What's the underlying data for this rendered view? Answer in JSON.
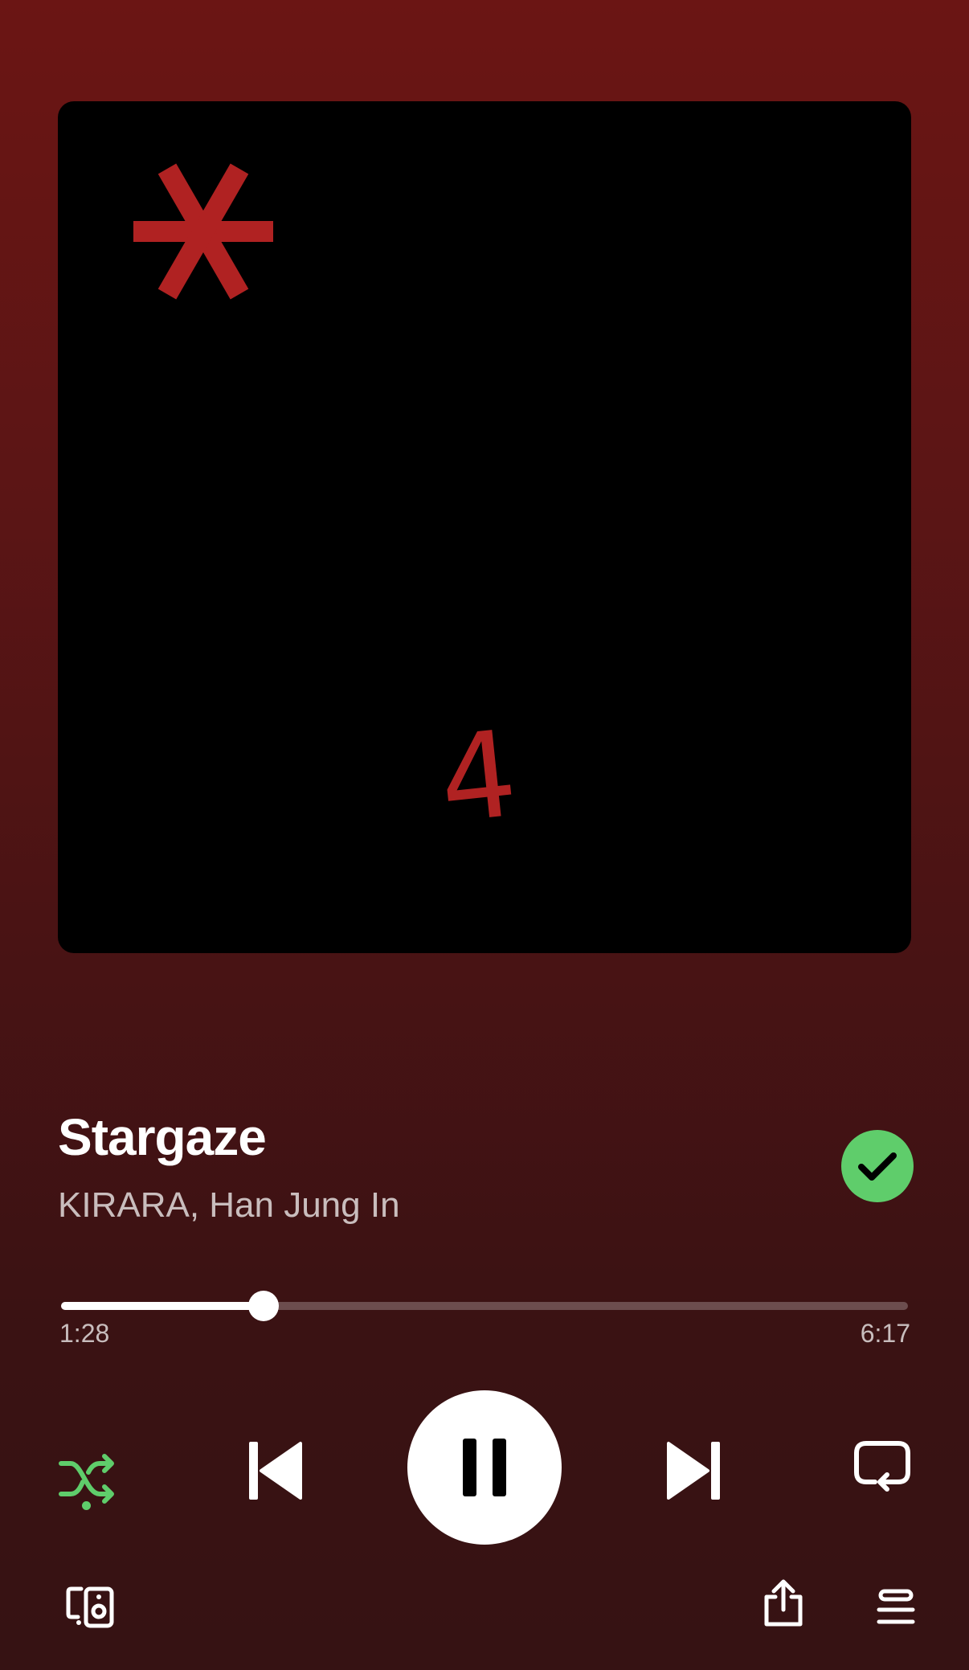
{
  "track": {
    "title": "Stargaze",
    "artists": "KIRARA, Han Jung In",
    "liked": true
  },
  "artwork": {
    "text": "4"
  },
  "playback": {
    "elapsed": "1:28",
    "total": "6:17",
    "progress_fraction": 0.2387,
    "state": "playing",
    "shuffle": true,
    "repeat": "off"
  },
  "icons": {
    "liked": "check-icon",
    "shuffle": "shuffle-icon",
    "previous": "skip-previous-icon",
    "play_pause": "pause-icon",
    "next": "skip-next-icon",
    "repeat": "repeat-icon",
    "devices": "connect-devices-icon",
    "share": "share-icon",
    "queue": "queue-icon"
  },
  "colors": {
    "accent": "#5fcd6b",
    "background_top": "#6b1514",
    "background_bottom": "#361213",
    "art_red": "#b02222"
  }
}
